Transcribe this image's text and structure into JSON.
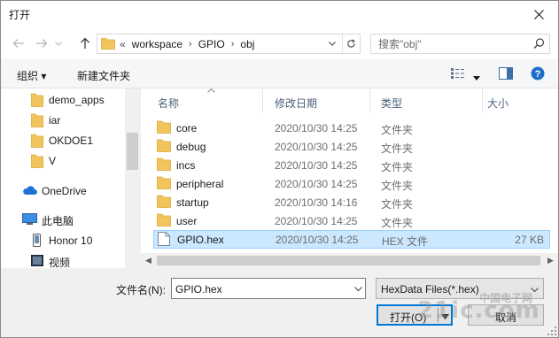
{
  "window": {
    "title": "打开"
  },
  "address": {
    "prefix": "«",
    "crumbs": [
      "workspace",
      "GPIO",
      "obj"
    ],
    "separator": "›"
  },
  "search": {
    "placeholder": "搜索\"obj\""
  },
  "toolbar": {
    "organize": "组织 ▾",
    "new_folder": "新建文件夹"
  },
  "sidebar": {
    "items": [
      {
        "label": "demo_apps",
        "icon": "folder-icon"
      },
      {
        "label": "iar",
        "icon": "folder-icon"
      },
      {
        "label": "OKDOE1",
        "icon": "folder-icon"
      },
      {
        "label": "V",
        "icon": "folder-icon"
      },
      {
        "label": "OneDrive",
        "icon": "onedrive-cloud-icon"
      },
      {
        "label": "此电脑",
        "icon": "computer-icon"
      },
      {
        "label": "Honor 10",
        "icon": "phone-icon"
      },
      {
        "label": "视频",
        "icon": "video-icon"
      }
    ]
  },
  "columns": {
    "name": "名称",
    "modified": "修改日期",
    "type": "类型",
    "size": "大小"
  },
  "files": [
    {
      "name": "core",
      "date": "2020/10/30 14:25",
      "type": "文件夹",
      "size": "",
      "icon": "folder-icon"
    },
    {
      "name": "debug",
      "date": "2020/10/30 14:25",
      "type": "文件夹",
      "size": "",
      "icon": "folder-icon"
    },
    {
      "name": "incs",
      "date": "2020/10/30 14:25",
      "type": "文件夹",
      "size": "",
      "icon": "folder-icon"
    },
    {
      "name": "peripheral",
      "date": "2020/10/30 14:25",
      "type": "文件夹",
      "size": "",
      "icon": "folder-icon"
    },
    {
      "name": "startup",
      "date": "2020/10/30 14:16",
      "type": "文件夹",
      "size": "",
      "icon": "folder-icon"
    },
    {
      "name": "user",
      "date": "2020/10/30 14:25",
      "type": "文件夹",
      "size": "",
      "icon": "folder-icon"
    },
    {
      "name": "GPIO.hex",
      "date": "2020/10/30 14:25",
      "type": "HEX 文件",
      "size": "27 KB",
      "icon": "file-icon",
      "selected": true
    }
  ],
  "bottom": {
    "filename_label": "文件名(N):",
    "filename_value": "GPIO.hex",
    "filter": "HexData Files(*.hex)",
    "open_label": "打开(O)",
    "cancel_label": "取消"
  },
  "watermark": {
    "top": "中国电子网",
    "main": "21ic.com"
  },
  "colors": {
    "selection": "#cce8ff",
    "folder": "#e8b84a",
    "accent": "#0078d7"
  }
}
